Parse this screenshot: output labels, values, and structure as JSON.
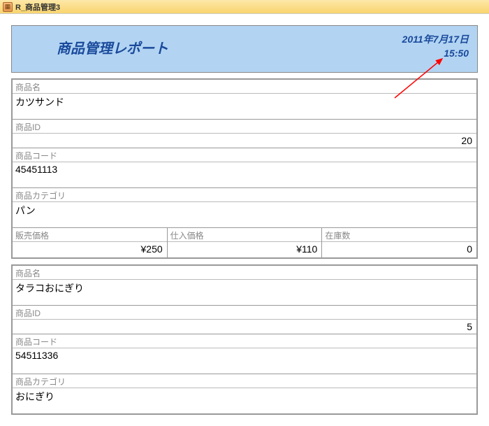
{
  "window": {
    "title": "R_商品管理3"
  },
  "report": {
    "title": "商品管理レポート",
    "date": "2011年7月17日",
    "time": "15:50"
  },
  "labels": {
    "product_name": "商品名",
    "product_id": "商品ID",
    "product_code": "商品コード",
    "category": "商品カテゴリ",
    "sale_price": "販売価格",
    "purchase_price": "仕入価格",
    "stock": "在庫数"
  },
  "records": [
    {
      "product_name": "カツサンド",
      "product_id": "20",
      "product_code": "45451113",
      "category": "パン",
      "sale_price": "¥250",
      "purchase_price": "¥110",
      "stock": "0"
    },
    {
      "product_name": "タラコおにぎり",
      "product_id": "5",
      "product_code": "54511336",
      "category": "おにぎり",
      "sale_price": "",
      "purchase_price": "",
      "stock": ""
    }
  ]
}
